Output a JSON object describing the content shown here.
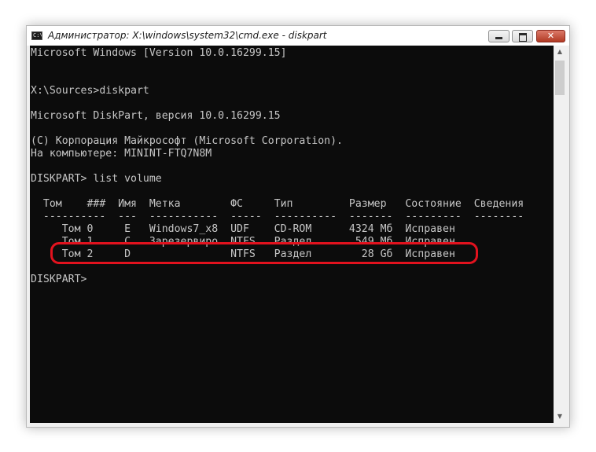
{
  "window": {
    "title": "Администратор: X:\\windows\\system32\\cmd.exe - diskpart",
    "icon_label": "C:\\",
    "buttons": {
      "minimize": "minimize-icon",
      "maximize": "maximize-icon",
      "close_label": "✕"
    }
  },
  "console": {
    "lines": [
      "Microsoft Windows [Version 10.0.16299.15]",
      "",
      "",
      "X:\\Sources>diskpart",
      "",
      "Microsoft DiskPart, версия 10.0.16299.15",
      "",
      "(C) Корпорация Майкрософт (Microsoft Corporation).",
      "На компьютере: MININT-FTQ7N8M",
      "",
      "DISKPART> list volume",
      "",
      "  Том    ###  Имя  Метка        ФС     Тип         Размер   Состояние  Сведения",
      "  ----------  ---  -----------  -----  ----------  -------  ---------  --------",
      "     Том 0     E   Windows7_x8  UDF    CD-ROM      4324 Мб  Исправен",
      "     Том 1     C   Зарезервиро  NTFS   Раздел       549 Мб  Исправен",
      "     Том 2     D                NTFS   Раздел        28 Gб  Исправен",
      "",
      "DISKPART>"
    ]
  },
  "scrollbar": {
    "up_icon": "▲",
    "down_icon": "▼"
  },
  "annotation": {
    "color": "#e2121e",
    "marked_row": "Том 2"
  }
}
